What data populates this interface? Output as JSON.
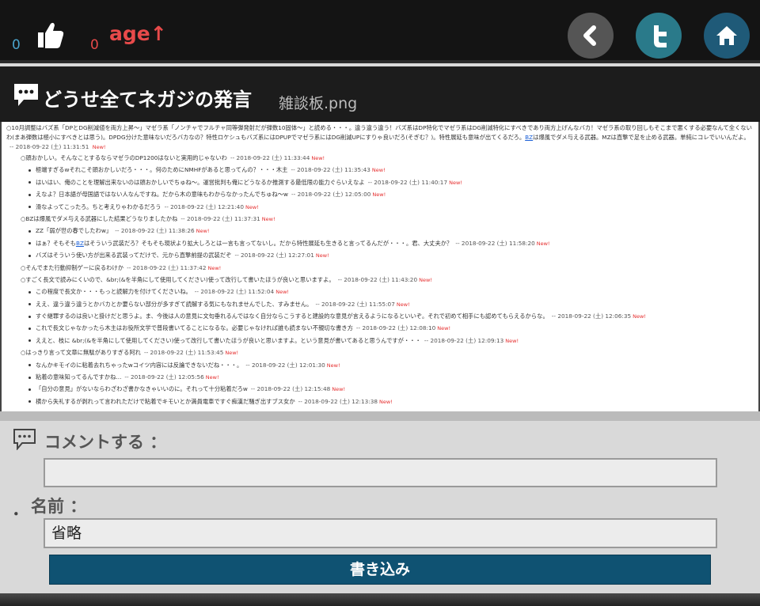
{
  "topbar": {
    "likes_count": "0",
    "age_count": "0",
    "age_label": "age↑",
    "icons": [
      "thumbs-up-icon",
      "back-icon",
      "twitter-icon",
      "home-icon"
    ],
    "colors": {
      "count": "#4aa3cc",
      "age": "#e84a4a",
      "twitter": "#2a7a8a",
      "home": "#1f5a78"
    }
  },
  "titlebar": {
    "title": "どうせ全てネガジの発言",
    "subtitle": "雑談板.png"
  },
  "screenshot": {
    "first_post": {
      "text": "○10月調整はバズ系「DPとDG削減値を両方上昇〜」マゼラ系「ノンチャでフルチャ同等弾発射だが弾数10固体〜」と読める・・・。違う違う違う！バズ系はDP特化でマゼラ系はDG削減特化にすべきであり両方上げんなバカ！マゼラ系の取り回しもそこまで悪くする必要なんて全くないわ(まあ弾数は極小にすべきとは思う)。DPDG分けた意味ないだろバカなの？特性ロケシュもバズ系にはDPUPでマゼラ系にはDG削減UPにすりゃ良いだろ(そぎむ？)。特性展延も意味が出てくるだろ。",
      "link": "BZ",
      "tail": "は爆風でダメ与える武器。MZは直撃で足を止める武器。単純にコレでいいんだよ。",
      "meta": "-- 2018-09-22 (土) 11:31:51",
      "new": "New!"
    },
    "replies": [
      {
        "type": "circle",
        "text": "○頭おかしい。そんなことするならマゼラのDP1200はないと実用的じゃないわ",
        "meta": "-- 2018-09-22 (土) 11:33:44",
        "new": "New!"
      },
      {
        "type": "bullet",
        "text": "極端すぎるwそれこそ頭おかしいだろ・・・。何のためにNMHFがあると思ってんの？・・・木主",
        "meta": "-- 2018-09-22 (土) 11:35:43",
        "new": "New!"
      },
      {
        "type": "bullet",
        "text": "はいはい、俺のことを理解出来ないのは頭おかしいでちゅね〜。運営批判も俺にどうなるか推測する最低限の能力ぐらいえなよ",
        "meta": "-- 2018-09-22 (土) 11:40:17",
        "new": "New!"
      },
      {
        "type": "bullet",
        "text": "えなよ？日本語が母国語ではない人なんですね。だから木の意味もわからなかったんでちゅね〜w",
        "meta": "-- 2018-09-22 (土) 12:05:00",
        "new": "New!"
      },
      {
        "type": "bullet",
        "text": "滑なよってこったろ。ちと考えりゃわかるだろう",
        "meta": "-- 2018-09-22 (土) 12:21:40",
        "new": "New!"
      },
      {
        "type": "circle",
        "text": "○BZは爆風でダメ与える武器にした結果どうなりましたかね",
        "meta": "-- 2018-09-22 (土) 11:37:31",
        "new": "New!"
      },
      {
        "type": "bullet",
        "text": "ZZ「弱が世の春でしたわw」",
        "meta": "-- 2018-09-22 (土) 11:38:26",
        "new": "New!"
      },
      {
        "type": "bullet",
        "text_before": "はぁ？そもそも",
        "link": "BZ",
        "text": "はそういう武装だろ？そもそも現状より拡大しろとは一言も言ってないし。だから特性展延も生きると言ってるんだが・・・。君、大丈夫か？",
        "meta": "-- 2018-09-22 (土) 11:58:20",
        "new": "New!"
      },
      {
        "type": "bullet",
        "text": "バズはそういう使い方が出来る武装ってだけで、元から直撃前提の武装だぞ",
        "meta": "-- 2018-09-22 (土) 12:27:01",
        "new": "New!"
      },
      {
        "type": "circle",
        "text": "○そんでまた行動抑制ゲーに戻るわけか",
        "meta": "-- 2018-09-22 (土) 11:37:42",
        "new": "New!"
      },
      {
        "type": "circle",
        "text": "○すごく長文で読みにくいので、&br;(&を半角にして使用してください)使って改行して書いたほうが良いと思いますよ。",
        "meta": "-- 2018-09-22 (土) 11:43:20",
        "new": "New!"
      },
      {
        "type": "bullet",
        "text": "この程度で長文か・・・もっと読解力を付けてくださいね。",
        "meta": "-- 2018-09-22 (土) 11:52:04",
        "new": "New!"
      },
      {
        "type": "bullet",
        "text": "ええ、違う違う違うとかバカとか要らない部分が多すぎて読解する気にもなれませんでした、すみません。",
        "meta": "-- 2018-09-22 (土) 11:55:07",
        "new": "New!"
      },
      {
        "type": "bullet",
        "text": "すぐ継罪するのは良いと掛けだと思うよ。ま、今後は人の意見に文句垂れるんではなく自分ならこうすると建設的な意見が言えるようになるといいぞ。それで初めて相手にも認めてもらえるからな。",
        "meta": "-- 2018-09-22 (土) 12:06:35",
        "new": "New!"
      },
      {
        "type": "bullet",
        "text": "これで長文じゃなかったら木主はお役所文学で普段書いてることになるな。必要じゃなければ誰も読まない不親切な書き方",
        "meta": "-- 2018-09-22 (土) 12:08:10",
        "new": "New!"
      },
      {
        "type": "bullet",
        "text": "ええと、枝に &br;(&を半角にして使用してください)使って改行して書いたほうが良いと思いますよ。という意見が書いてあると思うんですが・・・",
        "meta": "-- 2018-09-22 (土) 12:09:13",
        "new": "New!"
      },
      {
        "type": "circle",
        "text": "○はっきり言って文章に無駄がありすぎる阿れ",
        "meta": "-- 2018-09-22 (土) 11:53:45",
        "new": "New!"
      },
      {
        "type": "bullet",
        "text": "なんかキモイのに粘着去れちゃったwコイツ内容には反論できないだね・・・。",
        "meta": "-- 2018-09-22 (土) 12:01:30",
        "new": "New!"
      },
      {
        "type": "bullet",
        "text": "粘着の意味知ってるんですかね...",
        "meta": "-- 2018-09-22 (土) 12:05:56",
        "new": "New!"
      },
      {
        "type": "bullet",
        "text": "「自分の意見」がないならわざわざ書かなきゃいいのに。それって十分粘着だろw",
        "meta": "-- 2018-09-22 (土) 12:15:48",
        "new": "New!"
      },
      {
        "type": "bullet",
        "text": "横から失礼するが剥れって言われただけで粘着でキモいとか満員電車ですぐ痴漢だ騒ぎ出すブス女か",
        "meta": "-- 2018-09-22 (土) 12:13:38",
        "new": "New!"
      }
    ]
  },
  "form": {
    "comment_label": "コメントする ：",
    "comment_value": "",
    "bullet": "．",
    "name_label": "名前 ：",
    "name_value": "省略",
    "submit_label": "書き込み",
    "colors": {
      "submit": "#0f5272"
    }
  }
}
